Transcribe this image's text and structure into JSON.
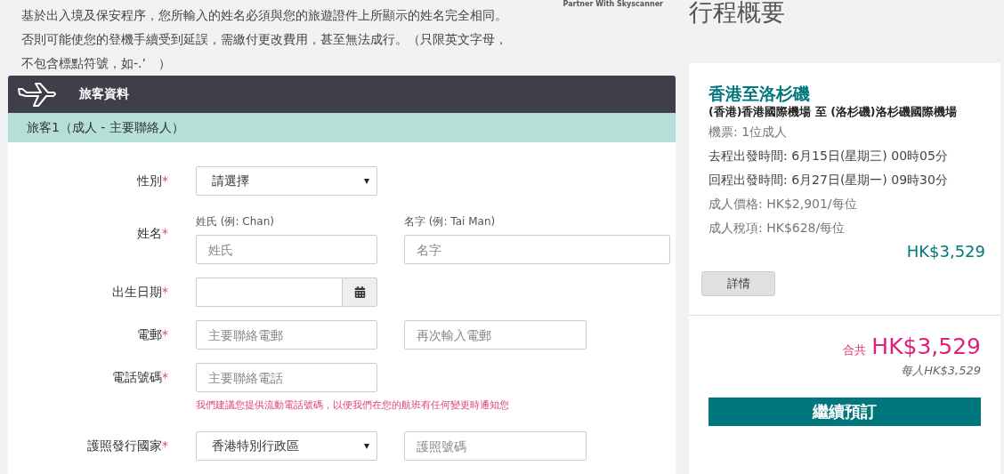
{
  "notice": {
    "lines": [
      "基於出入境及保安程序，您所輸入的姓名必須與您的旅遊證件上所顯示的姓名完全相同。",
      "否則可能使您的登機手續受到延誤，需繳付更改費用，甚至無法成行。（只限英文字母，",
      "不包含標點符號，如-.’　）"
    ]
  },
  "partner": "Partner With Skyscanner",
  "section": {
    "title": "旅客資料",
    "traveller": "旅客1（成人 - 主要聯絡人）"
  },
  "form": {
    "required_mark": "*",
    "rows": [
      {
        "kind": "single",
        "label": "性別",
        "fields": [
          {
            "kind": "select",
            "value": "請選擇"
          }
        ]
      },
      {
        "kind": "name",
        "label": "姓名",
        "fields": [
          {
            "kind": "input",
            "caption": "姓氏 (例: Chan)",
            "placeholder": "姓氏"
          },
          {
            "kind": "input",
            "caption": "名字 (例: Tai Man)",
            "placeholder": "名字"
          }
        ]
      },
      {
        "kind": "single",
        "label": "出生日期",
        "fields": [
          {
            "kind": "date"
          }
        ]
      },
      {
        "kind": "pair",
        "label": "電郵",
        "fields": [
          {
            "kind": "input",
            "placeholder": "主要聯絡電郵"
          },
          {
            "kind": "input",
            "placeholder": "再次輸入電郵"
          }
        ]
      },
      {
        "kind": "single",
        "label": "電話號碼",
        "fields": [
          {
            "kind": "input",
            "placeholder": "主要聯絡電話"
          }
        ],
        "hint": "我們建議您提供流動電話號碼，以便我們在您的航班有任何變更時通知您"
      },
      {
        "kind": "pair",
        "label": "護照發行國家",
        "fields": [
          {
            "kind": "select",
            "value": "香港特別行政區"
          },
          {
            "kind": "input",
            "placeholder": "護照號碼"
          }
        ]
      }
    ]
  },
  "summary": {
    "heading": "行程概要",
    "route": "香港至洛杉磯",
    "airports": "(香港)香港國際機場 至 (洛杉磯)洛杉磯國際機場",
    "tickets": "機票: 1位成人",
    "outbound": "去程出發時間: 6月15日(星期三) 00時05分",
    "return": "回程出發時間: 6月27日(星期一) 09時30分",
    "adult_price": "成人價格: HK$2,901/每位",
    "adult_tax": "成人稅項: HK$628/每位",
    "subtotal": "HK$3,529",
    "details_button": "詳情",
    "total_label": "合共",
    "total": "HK$3,529",
    "per_person": "每人HK$3,529",
    "continue_button": "繼續預訂"
  }
}
